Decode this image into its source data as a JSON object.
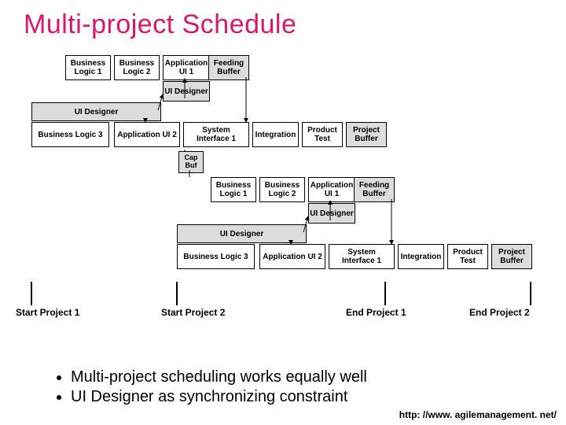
{
  "title": "Multi-project Schedule",
  "proj1": {
    "row1": {
      "bl1": "Business Logic 1",
      "bl2": "Business Logic 2",
      "au1": "Application UI 1",
      "fb": "Feeding Buffer"
    },
    "uiDesignerSmall": "UI Designer",
    "uiDesignerLong": "UI Designer",
    "row2": {
      "bl3": "Business Logic 3",
      "au2": "Application UI 2",
      "si1": "System Interface 1",
      "int": "Integration",
      "pt": "Product Test",
      "pb": "Project Buffer"
    }
  },
  "capBuf": "Cap Buf",
  "proj2": {
    "row1": {
      "bl1": "Business Logic 1",
      "bl2": "Business Logic 2",
      "au1": "Application UI 1",
      "fb": "Feeding Buffer"
    },
    "uiDesignerSmall": "UI Designer",
    "uiDesignerLong": "UI Designer",
    "row2": {
      "bl3": "Business Logic 3",
      "au2": "Application UI 2",
      "si1": "System Interface 1",
      "int": "Integration",
      "pt": "Product Test",
      "pb": "Project Buffer"
    }
  },
  "markers": {
    "startP1": "Start Project 1",
    "startP2": "Start Project 2",
    "endP1": "End Project 1",
    "endP2": "End Project 2"
  },
  "bullets": {
    "b1": "Multi-project scheduling works equally well",
    "b2": "UI Designer as synchronizing constraint"
  },
  "footer": "http: //www. agilemanagement. net/"
}
